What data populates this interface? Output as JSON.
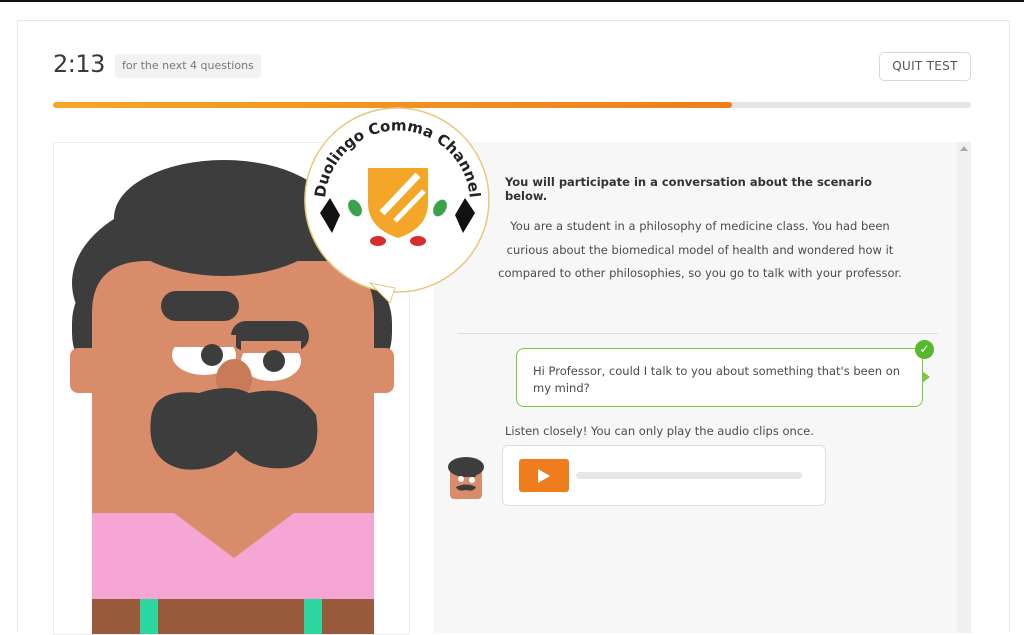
{
  "header": {
    "timer": "2:13",
    "timer_note": "for the next 4 questions",
    "quit_label": "QUIT TEST",
    "progress_fraction": 0.74
  },
  "scenario": {
    "title": "You will participate in a conversation about the scenario below.",
    "body": "You are a student in a philosophy of medicine class. You had been curious about the biomedical model of health and wondered how it compared to other philosophies, so you go to talk with your professor."
  },
  "conversation": {
    "user_message": "Hi Professor, could I talk to you about something that's been on my mind?",
    "listen_note": "Listen closely! You can only play the audio clips once."
  },
  "watermark": {
    "text": "Duolingo Comma Channel"
  },
  "icons": {
    "check": "check-circle-icon",
    "play": "play-icon"
  },
  "colors": {
    "progress": "#ee7e1b",
    "play_button": "#f07d1d",
    "bubble_border": "#78c93f",
    "character_skin": "#d98c6a",
    "character_shirt": "#f6a6d4"
  }
}
